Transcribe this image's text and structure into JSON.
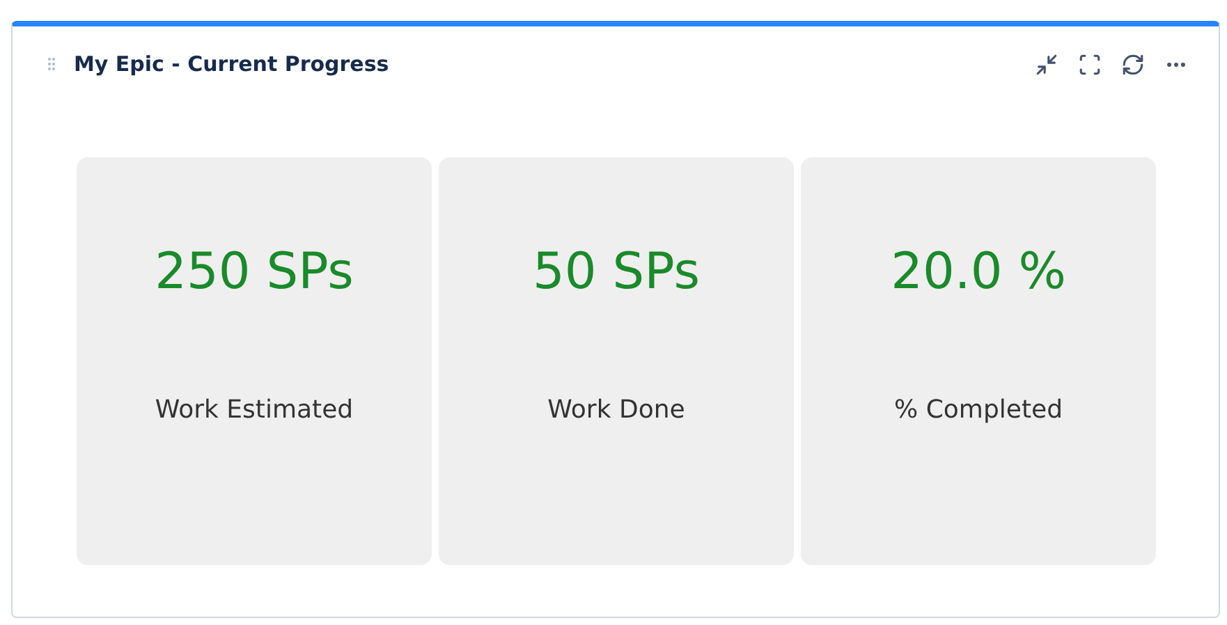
{
  "widget": {
    "title": "My Epic - Current Progress"
  },
  "metrics": [
    {
      "value": "250 SPs",
      "label": "Work Estimated"
    },
    {
      "value": "50 SPs",
      "label": "Work Done"
    },
    {
      "value": "20.0 %",
      "label": "% Completed"
    }
  ]
}
